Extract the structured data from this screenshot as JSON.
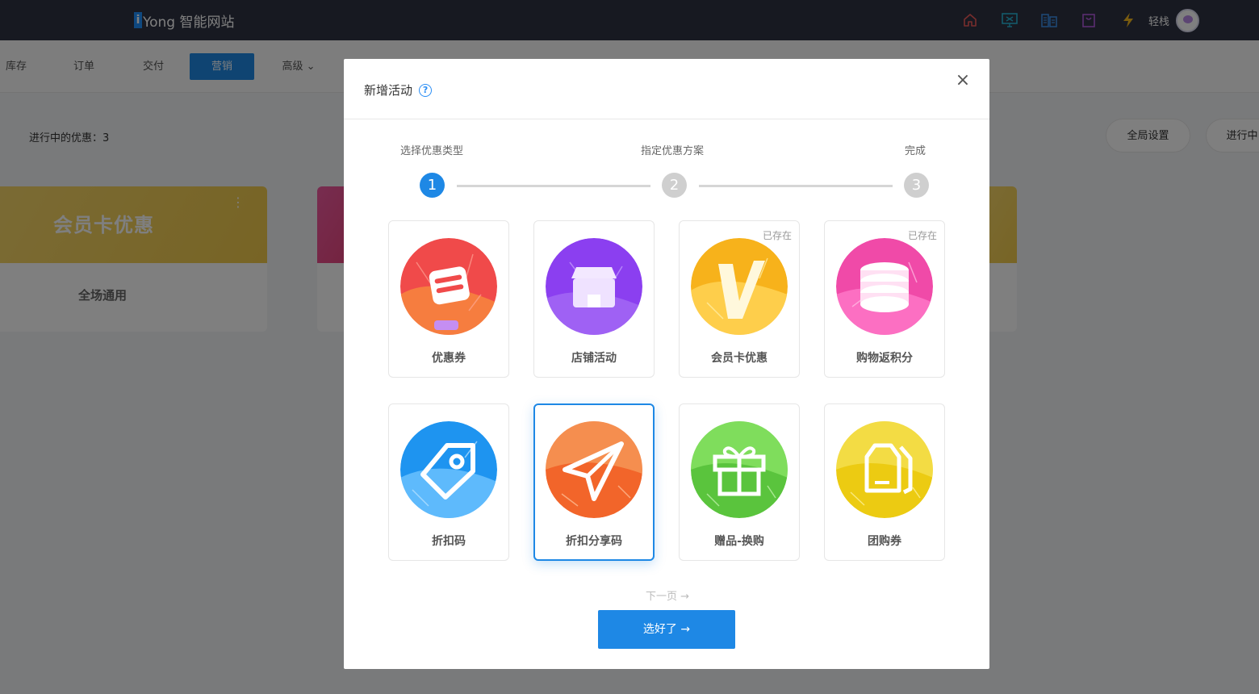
{
  "app": {
    "logo_mark": "i",
    "logo_text": "Yong 智能网站"
  },
  "header": {
    "icons": [
      "home-icon",
      "monitor-icon",
      "building-icon",
      "bag-icon",
      "lightning-icon"
    ],
    "user_name": "轻栈"
  },
  "nav": {
    "items": [
      {
        "label": "库存",
        "active": false
      },
      {
        "label": "订单",
        "active": false
      },
      {
        "label": "交付",
        "active": false
      },
      {
        "label": "营销",
        "active": true
      },
      {
        "label": "高级 ⌄",
        "active": false
      }
    ]
  },
  "page": {
    "active_count_label": "进行中的优惠：3",
    "global_settings_label": "全局设置",
    "in_progress_label": "进行中",
    "card": {
      "title": "会员卡优惠",
      "subtitle": "全场通用",
      "menu": "⋮"
    }
  },
  "modal": {
    "title": "新增活动",
    "help_icon": "?",
    "close_icon": "×",
    "steps": [
      {
        "label": "选择优惠类型",
        "number": "1",
        "active": true
      },
      {
        "label": "指定优惠方案",
        "number": "2",
        "active": false
      },
      {
        "label": "完成",
        "number": "3",
        "active": false
      }
    ],
    "tiles": [
      {
        "label": "优惠券",
        "badge": "",
        "icon": "coupon-icon",
        "selected": false
      },
      {
        "label": "店铺活动",
        "badge": "",
        "icon": "store-icon",
        "selected": false
      },
      {
        "label": "会员卡优惠",
        "badge": "已存在",
        "icon": "vip-icon",
        "selected": false
      },
      {
        "label": "购物返积分",
        "badge": "已存在",
        "icon": "points-icon",
        "selected": false
      },
      {
        "label": "折扣码",
        "badge": "",
        "icon": "tag-icon",
        "selected": false
      },
      {
        "label": "折扣分享码",
        "badge": "",
        "icon": "paper-plane-icon",
        "selected": true
      },
      {
        "label": "赠品-换购",
        "badge": "",
        "icon": "gift-icon",
        "selected": false
      },
      {
        "label": "团购券",
        "badge": "",
        "icon": "group-ticket-icon",
        "selected": false
      }
    ],
    "next_page_label": "下一页 →",
    "confirm_label": "选好了 →"
  },
  "colors": {
    "topbar": "#2f3342",
    "accent": "#1e88e5",
    "coupon": "#f04a4a",
    "store": "#8b3ff0",
    "vip": "#f7b21b",
    "points": "#f04aa8",
    "tag": "#1e94f0",
    "plane": "#f2652a",
    "gift": "#5ac43d",
    "group": "#eccb12"
  }
}
